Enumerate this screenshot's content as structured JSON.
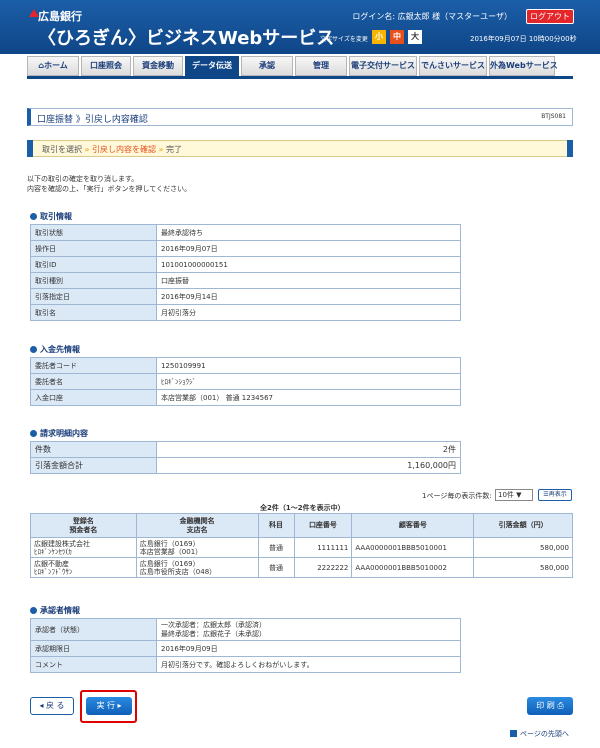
{
  "header": {
    "bank_name": "広島銀行",
    "service_name": "〈ひろぎん〉ビジネスWebサービス",
    "login_text": "ログイン名: 広銀太郎 様（マスターユーザ）",
    "logout_label": "ログアウト",
    "font_size_label": "文字サイズを変更",
    "font_small": "小",
    "font_medium": "中",
    "font_large": "大",
    "datetime": "2016年09月07日 10時00分00秒"
  },
  "nav": {
    "items": [
      {
        "label": "ホーム"
      },
      {
        "label": "口座照会"
      },
      {
        "label": "資金移動"
      },
      {
        "label": "データ伝送"
      },
      {
        "label": "承認"
      },
      {
        "label": "管理"
      },
      {
        "label": "電子交付サービス"
      },
      {
        "label": "でんさいサービス"
      },
      {
        "label": "外為Webサービス"
      }
    ],
    "active": "データ伝送"
  },
  "title": {
    "text": "口座振替 》引戻し内容確認",
    "screen_id": "BTJS081"
  },
  "steps": {
    "step1": "取引を選択",
    "sep": "»",
    "step2": "引戻し内容を確認",
    "step3": "完了"
  },
  "intro": {
    "line1": "以下の取引の確定を取り消します。",
    "line2": "内容を確認の上、「実行」ボタンを押してください。"
  },
  "transaction": {
    "title": "取引情報",
    "rows": [
      {
        "k": "取引状態",
        "v": "最終承認待ち"
      },
      {
        "k": "操作日",
        "v": "2016年09月07日"
      },
      {
        "k": "取引ID",
        "v": "101001000000151"
      },
      {
        "k": "取引種別",
        "v": "口座振替"
      },
      {
        "k": "引落指定日",
        "v": "2016年09月14日"
      },
      {
        "k": "取引名",
        "v": "月初引落分"
      }
    ]
  },
  "deposit": {
    "title": "入金先情報",
    "rows": [
      {
        "k": "委託者コード",
        "v": "1250109991"
      },
      {
        "k": "委託者名",
        "v": "ﾋﾛｷﾞﾝｼｮｳｼﾞ"
      },
      {
        "k": "入金口座",
        "v": "本店営業部（001） 普通 1234567"
      }
    ]
  },
  "billing": {
    "title": "請求明細内容",
    "count_label": "件数",
    "count_value": "2件",
    "total_label": "引落金額合計",
    "total_value": "1,160,000円"
  },
  "list": {
    "per_page_label": "1ページ毎の表示件数:",
    "per_page_value": "10件 ▼",
    "redisplay_label": "再表示",
    "count_text": "全2件（1～2件を表示中）",
    "headers": {
      "payer_line1": "登録名",
      "payer_line2": "預金者名",
      "bank_line1": "金融機関名",
      "bank_line2": "支店名",
      "subject": "科目",
      "account": "口座番号",
      "customer": "顧客番号",
      "amount": "引落金額（円）"
    },
    "rows": [
      {
        "name1": "広銀建設株式会社",
        "name2": "ﾋﾛｷﾞﾝｹﾝｾﾂ(ｶ",
        "bank1": "広島銀行（0169）",
        "bank2": "本店営業部（001）",
        "subject": "普通",
        "account": "1111111",
        "customer": "AAA0000001BBB5010001",
        "amount": "580,000"
      },
      {
        "name1": "広銀不動産",
        "name2": "ﾋﾛｷﾞﾝﾌﾄﾞｳｻﾝ",
        "bank1": "広島銀行（0169）",
        "bank2": "広島市役所支店（048）",
        "subject": "普通",
        "account": "2222222",
        "customer": "AAA0000001BBB5010002",
        "amount": "580,000"
      }
    ]
  },
  "approver": {
    "title": "承認者情報",
    "status_label": "承認者（状態）",
    "status_line1": "一次承認者：広銀太郎（承認済）",
    "status_line2": "最終承認者：広銀花子（未承認）",
    "deadline_label": "承認期限日",
    "deadline_value": "2016年09月09日",
    "comment_label": "コメント",
    "comment_value": "月初引落分です。確認よろしくおねがいします。"
  },
  "buttons": {
    "back": "◂ 戻 る",
    "execute": "実 行 ▸",
    "print": "印 刷 ⎙",
    "page_top": "ページの先頭へ"
  }
}
